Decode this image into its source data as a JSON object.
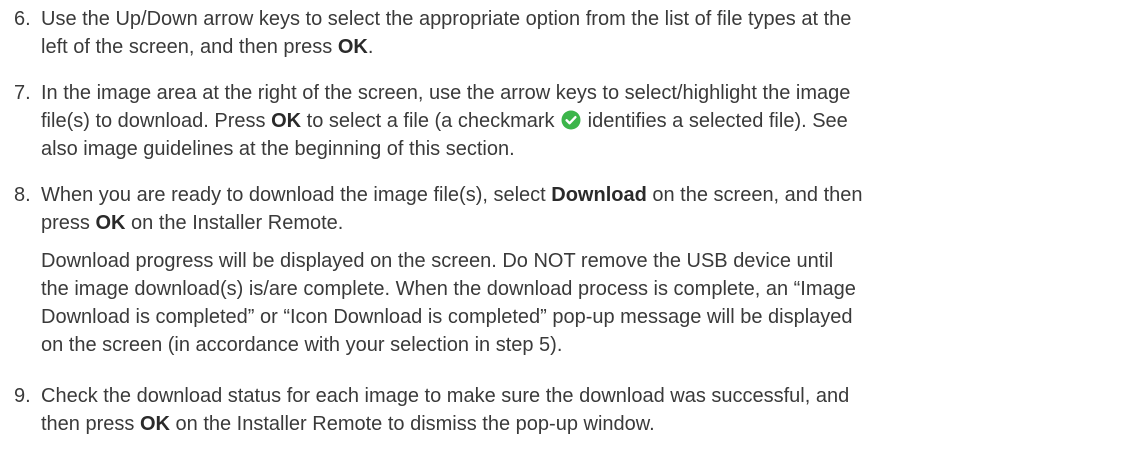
{
  "steps": [
    {
      "number": "6.",
      "line1": "Use the Up/Down arrow keys to select the appropriate option from the list of file types at the",
      "line2_a": "left of the screen, and then press ",
      "line2_b": "OK",
      "line2_c": "."
    },
    {
      "number": "7.",
      "line1": "In the image area at the right of the screen, use the arrow keys to select/highlight the image",
      "line2_a": "file(s) to download. Press ",
      "line2_b": "OK",
      "line2_c": " to select a file (a checkmark ",
      "icon": "green-checkmark-icon",
      "line2_d": " identifies a selected file). See",
      "line3": "also image guidelines at the beginning of this section."
    },
    {
      "number": "8.",
      "line1_a": "When you are ready to download the image file(s), select ",
      "line1_b": "Download",
      "line1_c": " on the screen, and then",
      "line2_a": "press ",
      "line2_b": "OK",
      "line2_c": " on the Installer Remote.",
      "note_line1": "Download progress will be displayed on the screen. Do NOT remove the USB device until",
      "note_line2": "the image download(s) is/are complete. When the download process is complete, an “Image",
      "note_line3": "Download is completed” or “Icon Download is completed” pop-up message will be displayed",
      "note_line4": "on the screen (in accordance with your selection in step 5)."
    },
    {
      "number": "9.",
      "line1": "Check the download status for each image to make sure the download was successful, and",
      "line2_a": "then press ",
      "line2_b": "OK",
      "line2_c": " on the Installer Remote to dismiss the pop-up window."
    }
  ],
  "colors": {
    "text": "#3a3a3a",
    "check_green": "#3cb54a"
  }
}
